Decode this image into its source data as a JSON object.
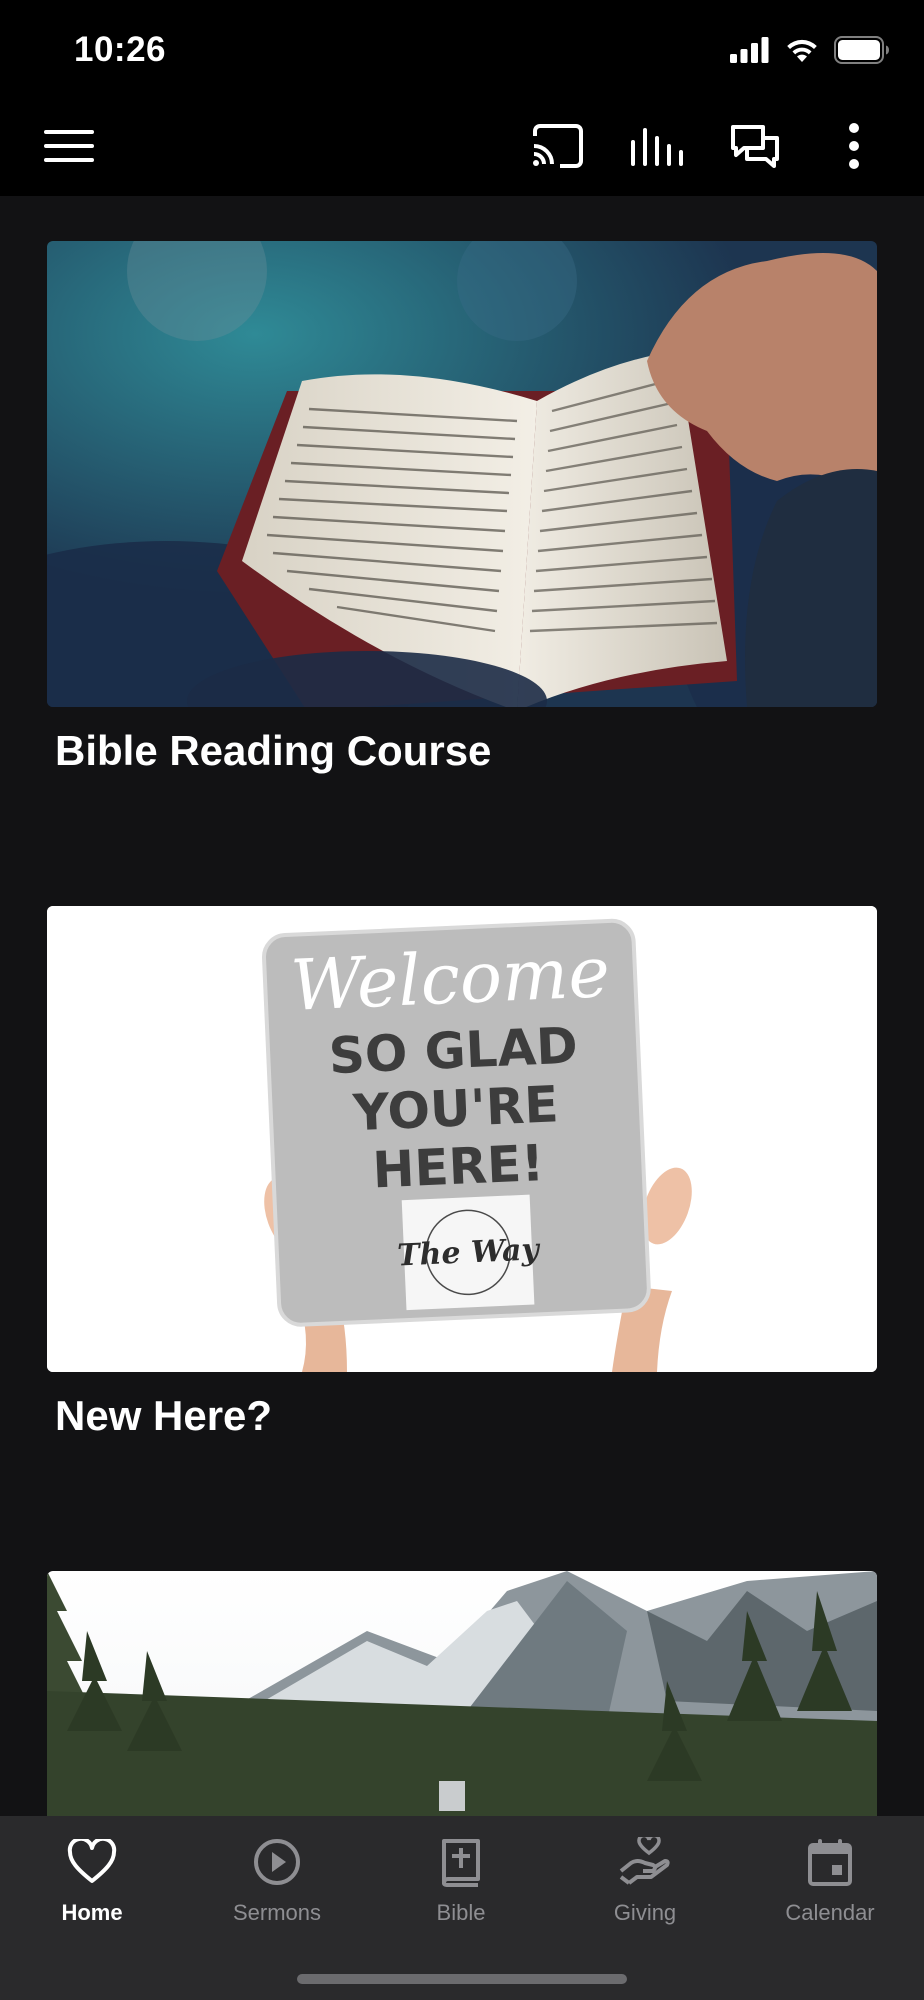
{
  "status_bar": {
    "time": "10:26"
  },
  "app_bar": {
    "icons": [
      "menu-icon",
      "cast-icon",
      "audio-bars-icon",
      "chat-icon",
      "more-vertical-icon"
    ]
  },
  "cards": [
    {
      "title": "Bible Reading Course",
      "image": "open-bible-photo"
    },
    {
      "title": "New Here?",
      "image": "welcome-sign-photo",
      "sign_text": {
        "script": "Welcome",
        "line1": "SO GLAD",
        "line2": "YOU'RE",
        "line3": "HERE!",
        "logo": "The Way"
      }
    },
    {
      "title": "",
      "image": "mountain-forest-photo"
    }
  ],
  "tabs": [
    {
      "label": "Home",
      "icon": "heart-icon",
      "active": true
    },
    {
      "label": "Sermons",
      "icon": "play-circle-icon",
      "active": false
    },
    {
      "label": "Bible",
      "icon": "book-plus-icon",
      "active": false
    },
    {
      "label": "Giving",
      "icon": "giving-hand-icon",
      "active": false
    },
    {
      "label": "Calendar",
      "icon": "calendar-icon",
      "active": false
    }
  ],
  "colors": {
    "background": "#121214",
    "top_bar": "#000000",
    "tab_bar": "#2a2a2c",
    "active_tab": "#ffffff",
    "inactive_tab": "#8e8e92"
  }
}
